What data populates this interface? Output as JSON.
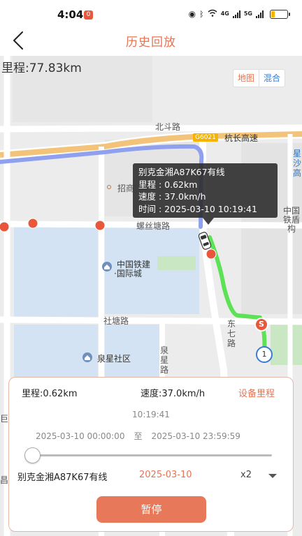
{
  "status_bar": {
    "time": "4:04",
    "badge": "0",
    "network_4g": "4G",
    "network_5g": "5G",
    "battery_level": 0.25
  },
  "header": {
    "title": "历史回放"
  },
  "map": {
    "total_distance": "里程:77.83km",
    "map_type": {
      "map_label": "地图",
      "hybrid_label": "混合"
    },
    "labels": {
      "beidou_road": "北斗路",
      "highway_code": "G6021",
      "highway_name": "杭长高速",
      "zhaoshang": "招商",
      "luositang_road": "螺丝塘路",
      "crcc_line1": "中国铁建",
      "crcc_line2": "·国际城",
      "shetang_road": "社塘路",
      "quanxing_community": "泉星社区",
      "dongqi_road": "东七路",
      "quanxing_road": "泉星路",
      "right_top": "星沙高",
      "right_mid": "中国铁盾构",
      "left_edge": "巨",
      "left_edge2": "昌",
      "route_marker_number": "1",
      "route_marker_start": "S"
    },
    "tooltip": {
      "plate": "别克金湘A87K67有线",
      "distance": "里程 : 0.62km",
      "speed": "速度 : 37.0km/h",
      "time": "时间 : 2025-03-10 10:19:41"
    }
  },
  "panel": {
    "distance": "里程:0.62km",
    "speed": "速度:37.0km/h",
    "device_mileage": "设备里程",
    "current_time": "10:19:41",
    "range_start": "2025-03-10 00:00:00",
    "range_sep": "至",
    "range_end": "2025-03-10 23:59:59",
    "playback_progress": 0.0,
    "plate": "别克金湘A87K67有线",
    "date": "2025-03-10",
    "speed_multiplier": "x2",
    "pause_label": "暂停"
  },
  "colors": {
    "accent": "#e57453",
    "track_done": "#8fa0ef",
    "track_remaining": "#5ee255",
    "button": "#e8785a"
  }
}
